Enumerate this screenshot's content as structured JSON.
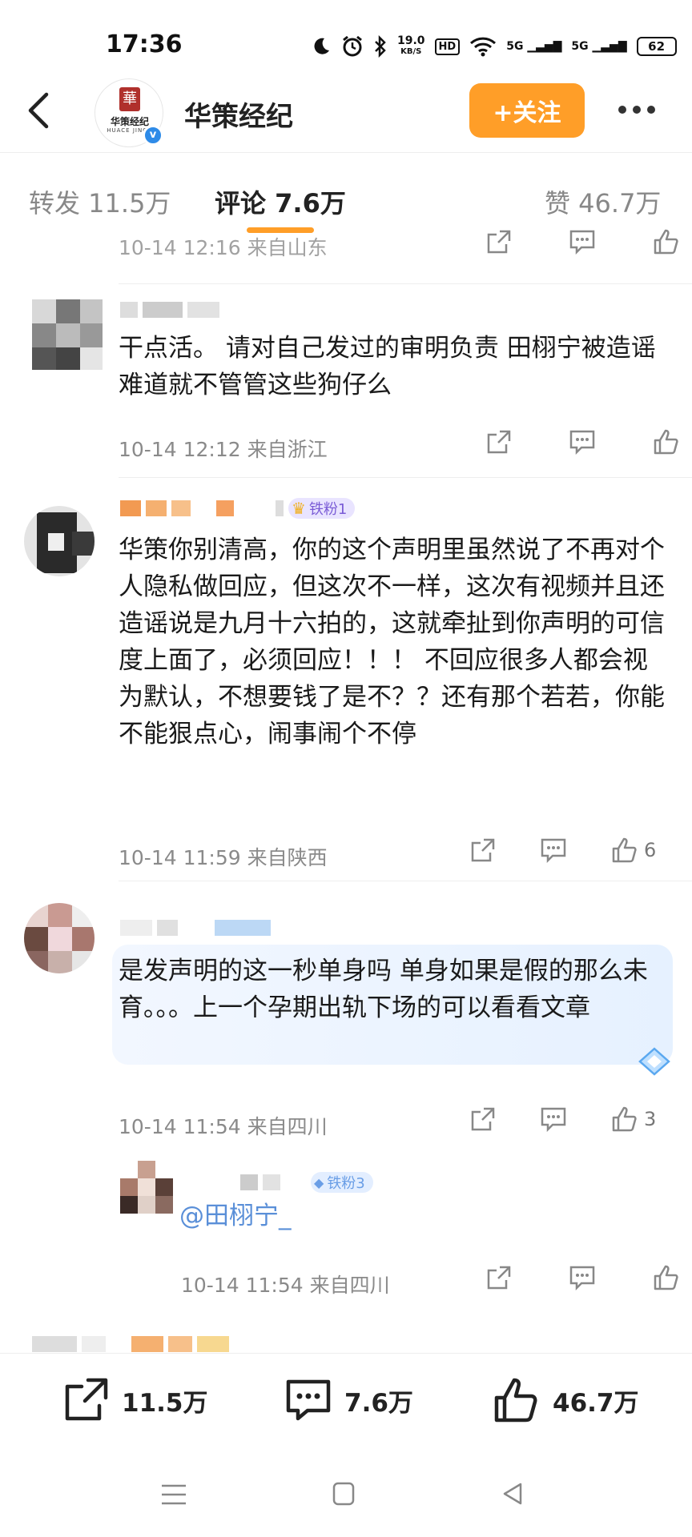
{
  "status_bar": {
    "time": "17:36",
    "net_speed": "19.0",
    "net_unit": "KB/S",
    "hd": "HD",
    "sig1": "5G",
    "sig2": "5G",
    "battery": "62",
    "icons": [
      "moon-icon",
      "alarm-icon",
      "bluetooth-icon",
      "hd-icon",
      "wifi-icon",
      "signal-icon",
      "signal-icon",
      "battery-icon"
    ]
  },
  "header": {
    "account_name": "华策经纪",
    "logo_text": "华策经纪",
    "logo_sub": "HUACE JINGJI",
    "follow_label": "+关注"
  },
  "tabs": {
    "repost": "转发 11.5万",
    "comments": "评论 7.6万",
    "likes": "赞 46.7万"
  },
  "comments": [
    {
      "meta": "10-14 12:16  来自山东",
      "likes": ""
    },
    {
      "text": "干点活。 请对自己发过的审明负责 田栩宁被造谣难道就不管管这些狗仔么",
      "meta": "10-14 12:12  来自浙江",
      "likes": ""
    },
    {
      "badge": "铁粉1",
      "text": "华策你别清高，你的这个声明里虽然说了不再对个人隐私做回应，但这次不一样，这次有视频并且还造谣说是九月十六拍的，这就牵扯到你声明的可信度上面了，必须回应！！！ 不回应很多人都会视为默认，不想要钱了是不？？还有那个若若，你能不能狠点心，闹事闹个不停",
      "meta": "10-14 11:59  来自陕西",
      "likes": "6"
    },
    {
      "text": "是发声明的这一秒单身吗 单身如果是假的那么未育。。。上一个孕期出轨下场的可以看看文章",
      "meta": "10-14 11:54  来自四川",
      "likes": "3"
    }
  ],
  "reply": {
    "badge": "铁粉3",
    "text": "@田栩宁_",
    "meta": "10-14 11:54  来自四川"
  },
  "bottom_bar": {
    "repost": "11.5万",
    "comment": "7.6万",
    "like": "46.7万"
  },
  "colors": {
    "accent": "#ff9e28",
    "verify": "#2e8be8",
    "badge_bg": "#e9e4ff"
  }
}
